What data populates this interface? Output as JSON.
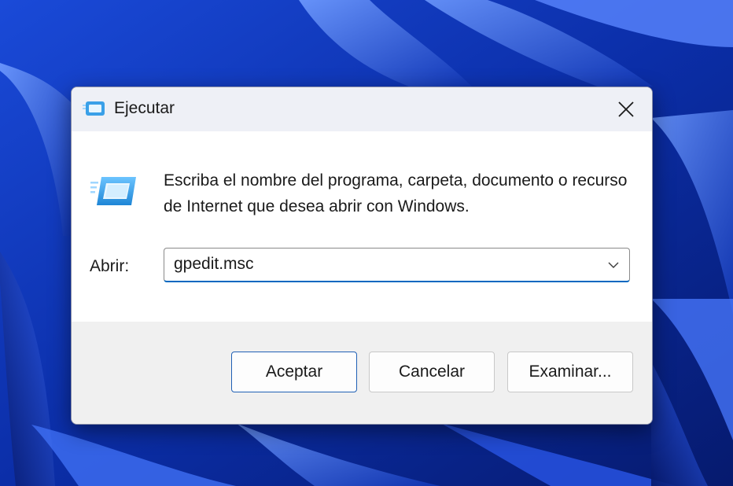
{
  "dialog": {
    "title": "Ejecutar",
    "icon": "run-icon",
    "close_icon": "close-icon",
    "description": "Escriba el nombre del programa, carpeta, documento o recurso de Internet que desea abrir con Windows.",
    "open_label": "Abrir:",
    "open_value": "gpedit.msc",
    "dropdown_icon": "chevron-down-icon",
    "buttons": {
      "ok": "Aceptar",
      "cancel": "Cancelar",
      "browse": "Examinar..."
    }
  },
  "colors": {
    "accent": "#0067c0",
    "wallpaper_dark": "#0a2a9c",
    "wallpaper_light": "#3d6fff"
  }
}
